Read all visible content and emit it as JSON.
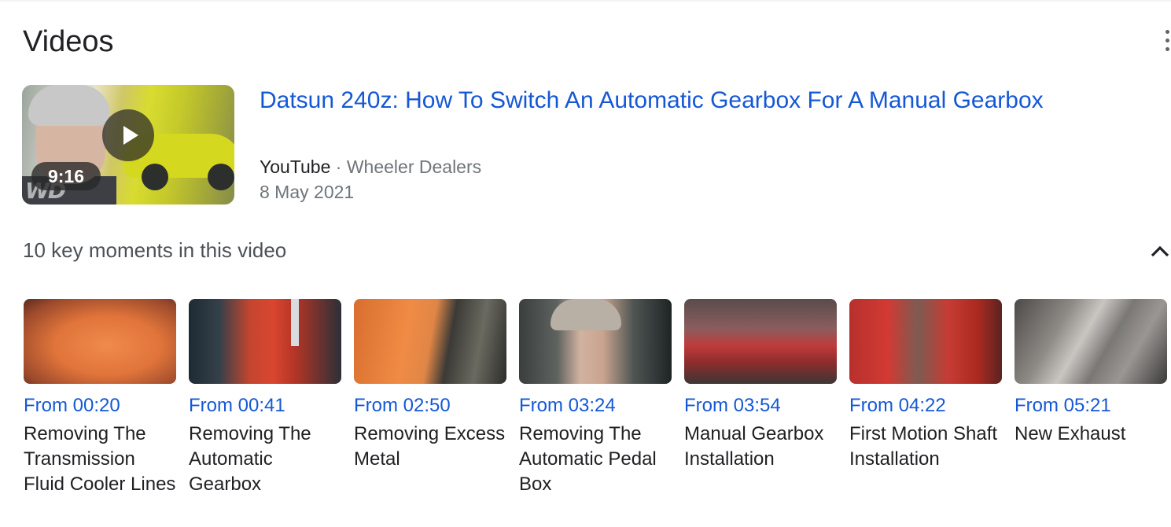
{
  "section": {
    "title": "Videos"
  },
  "video": {
    "title": "Datsun 240z: How To Switch An Automatic Gearbox For A Manual Gearbox",
    "duration": "9:16",
    "source": "YouTube",
    "separator": "·",
    "channel": "Wheeler Dealers",
    "date": "8 May 2021",
    "thumbnail_logo": "WD"
  },
  "key_moments": {
    "header": "10 key moments in this video",
    "items": [
      {
        "time": "From 00:20",
        "lines": [
          "Removing The",
          "Transmission",
          "Fluid Cooler Lines"
        ]
      },
      {
        "time": "From 00:41",
        "lines": [
          "Removing The",
          "Automatic",
          "Gearbox"
        ]
      },
      {
        "time": "From 02:50",
        "lines": [
          "Removing Excess",
          "Metal"
        ]
      },
      {
        "time": "From 03:24",
        "lines": [
          "Removing The",
          "Automatic Pedal",
          "Box"
        ]
      },
      {
        "time": "From 03:54",
        "lines": [
          "Manual Gearbox",
          "Installation"
        ]
      },
      {
        "time": "From 04:22",
        "lines": [
          "First Motion Shaft",
          "Installation"
        ]
      },
      {
        "time": "From 05:21",
        "lines": [
          "New Exhaust"
        ]
      }
    ]
  },
  "icons": {
    "more": "more-vert-icon",
    "collapse": "chevron-up-icon",
    "play": "play-icon"
  },
  "colors": {
    "link": "#1558d6",
    "text": "#202124",
    "secondary": "#70757a"
  }
}
